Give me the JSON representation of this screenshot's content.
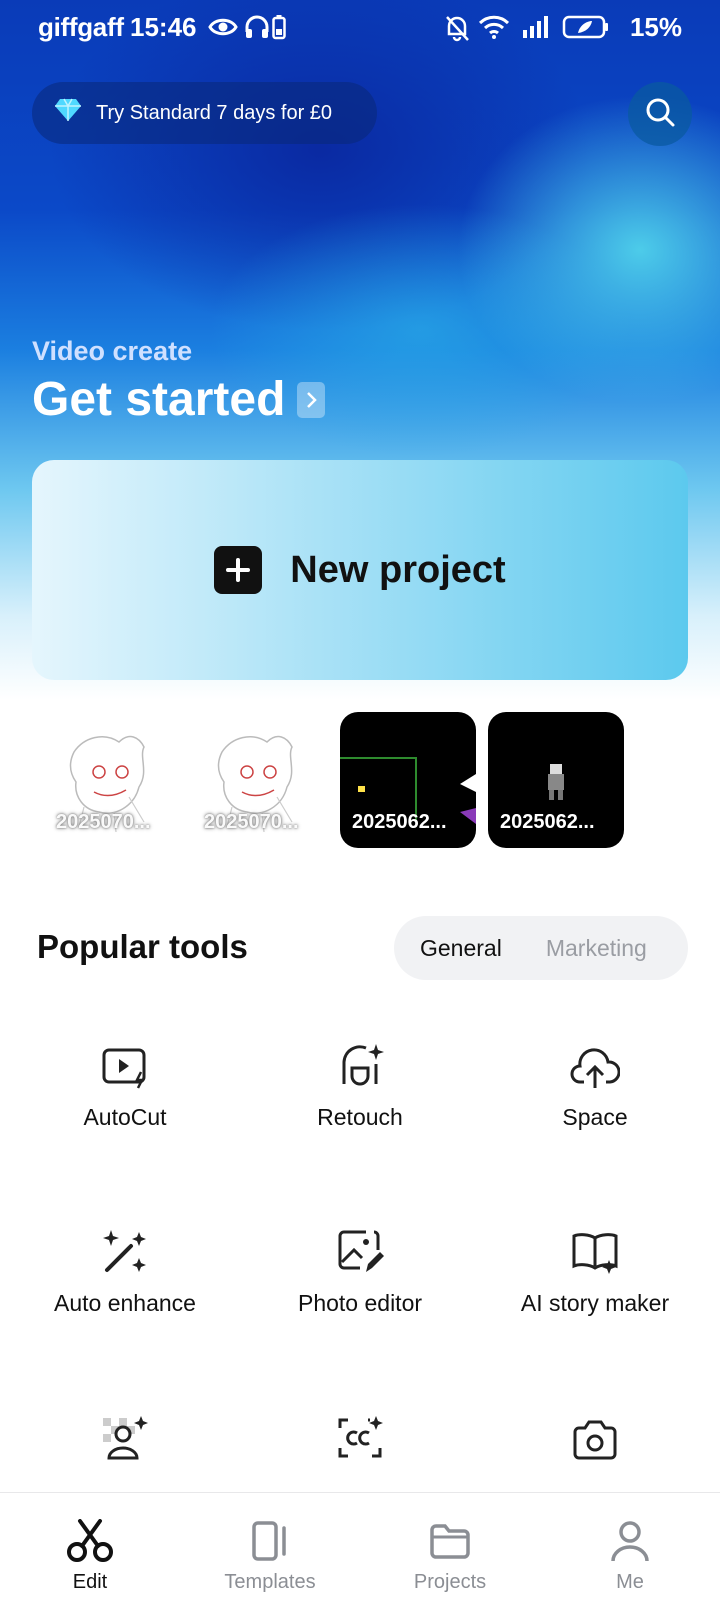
{
  "status_bar": {
    "carrier": "giffgaff",
    "time": "15:46",
    "battery": "15%"
  },
  "header": {
    "promo_label": "Try Standard 7 days for £0"
  },
  "hero": {
    "subtitle": "Video create",
    "title": "Get started",
    "new_project_label": "New project"
  },
  "recent_projects": [
    {
      "label": "2025070...",
      "style": "light"
    },
    {
      "label": "2025070...",
      "style": "light"
    },
    {
      "label": "2025062...",
      "style": "dark"
    },
    {
      "label": "2025062...",
      "style": "dark"
    }
  ],
  "tools": {
    "title": "Popular tools",
    "tabs": [
      "General",
      "Marketing"
    ],
    "active_tab": "General",
    "items": [
      {
        "label": "AutoCut",
        "icon": "autocut-icon"
      },
      {
        "label": "Retouch",
        "icon": "retouch-icon"
      },
      {
        "label": "Space",
        "icon": "cloud-upload-icon"
      },
      {
        "label": "Auto enhance",
        "icon": "magic-wand-icon"
      },
      {
        "label": "Photo editor",
        "icon": "photo-edit-icon"
      },
      {
        "label": "AI story maker",
        "icon": "book-sparkle-icon"
      },
      {
        "label": "",
        "icon": "remove-background-icon"
      },
      {
        "label": "",
        "icon": "auto-captions-icon"
      },
      {
        "label": "",
        "icon": "camera-icon"
      }
    ]
  },
  "bottom_nav": {
    "items": [
      {
        "label": "Edit",
        "icon": "scissors-icon"
      },
      {
        "label": "Templates",
        "icon": "templates-icon"
      },
      {
        "label": "Projects",
        "icon": "folder-icon"
      },
      {
        "label": "Me",
        "icon": "person-icon"
      }
    ],
    "active": "Edit"
  },
  "colors": {
    "accent_dark": "#111111",
    "inactive_text": "#9a9da3",
    "card_gradient_end": "#5cc9ee"
  }
}
